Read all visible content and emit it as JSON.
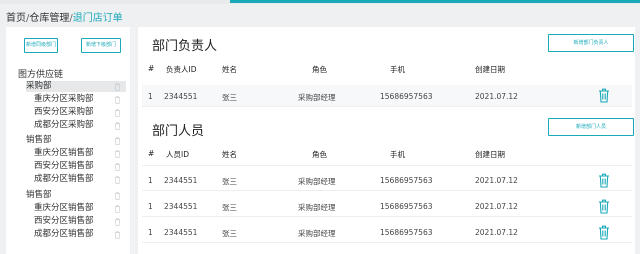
{
  "breadcrumb": {
    "home": "首页",
    "sep1": "/",
    "warehouse": "仓库管理",
    "sep2": "/",
    "current": "退门店订单"
  },
  "sidebar": {
    "btn_add_same": "新增同级部门",
    "btn_add_sub": "新增下级部门",
    "tree_root": "图方供应链",
    "items": [
      {
        "label": "采购部"
      },
      {
        "label": "重庆分区采购部"
      },
      {
        "label": "西安分区采购部"
      },
      {
        "label": "成都分区采购部"
      },
      {
        "label": "销售部"
      },
      {
        "label": "重庆分区销售部"
      },
      {
        "label": "西安分区销售部"
      },
      {
        "label": "成都分区销售部"
      },
      {
        "label": "销售部"
      },
      {
        "label": "重庆分区销售部"
      },
      {
        "label": "西安分区销售部"
      },
      {
        "label": "成都分区销售部"
      }
    ]
  },
  "leader": {
    "title": "部门负责人",
    "add_btn": "新增部门负责人",
    "headers": {
      "no": "#",
      "id": "负责人ID",
      "name": "姓名",
      "role": "角色",
      "phone": "手机",
      "date": "创建日期"
    },
    "rows": [
      {
        "no": "1",
        "id": "2344551",
        "name": "张三",
        "role": "采购部经理",
        "phone": "15686957563",
        "date": "2021.07.12"
      }
    ]
  },
  "members": {
    "title": "部门人员",
    "add_btn": "新增部门人员",
    "headers": {
      "no": "#",
      "id": "人员ID",
      "name": "姓名",
      "role": "角色",
      "phone": "手机",
      "date": "创建日期"
    },
    "rows": [
      {
        "no": "1",
        "id": "2344551",
        "name": "张三",
        "role": "采购部经理",
        "phone": "15686957563",
        "date": "2021.07.12"
      },
      {
        "no": "1",
        "id": "2344551",
        "name": "张三",
        "role": "采购部经理",
        "phone": "15686957563",
        "date": "2021.07.12"
      },
      {
        "no": "1",
        "id": "2344551",
        "name": "张三",
        "role": "采购部经理",
        "phone": "15686957563",
        "date": "2021.07.12"
      }
    ]
  },
  "colors": {
    "accent": "#1aa9b8"
  },
  "icons": {
    "delete": "trash-icon"
  }
}
